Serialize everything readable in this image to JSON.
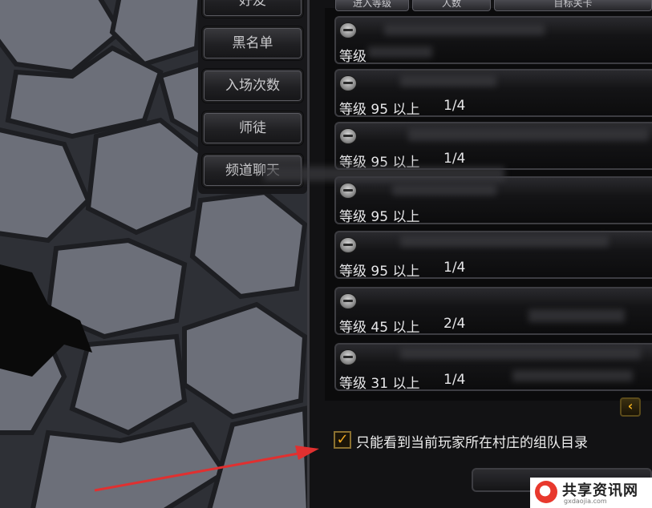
{
  "header_tabs": [
    {
      "label": "进入等级"
    },
    {
      "label": "人数"
    },
    {
      "label": "目标关卡"
    }
  ],
  "side_menu": {
    "items": [
      {
        "label": "好友"
      },
      {
        "label": "黑名单"
      },
      {
        "label": "入场次数"
      },
      {
        "label": "师徒"
      },
      {
        "label": "频道聊天"
      }
    ]
  },
  "party_list": [
    {
      "level": "等级",
      "count": ""
    },
    {
      "level": "等级 95 以上",
      "count": "1/4"
    },
    {
      "level": "等级 95 以上",
      "count": "1/4"
    },
    {
      "level": "等级 95 以上",
      "count": ""
    },
    {
      "level": "等级 95 以上",
      "count": "1/4"
    },
    {
      "level": "等级 45 以上",
      "count": "2/4"
    },
    {
      "level": "等级 31 以上",
      "count": "1/4"
    }
  ],
  "scroll_button": {
    "icon": "chevron-left-icon",
    "glyph": "‹",
    "color": "#f0b020"
  },
  "filter": {
    "checked": true,
    "check_glyph": "✓",
    "label": "只能看到当前玩家所在村庄的组队目录"
  },
  "annotation": {
    "type": "red-arrow",
    "color": "#e03030"
  },
  "watermark": {
    "text": "共享资讯网",
    "sub": "gxdaojia.com"
  }
}
